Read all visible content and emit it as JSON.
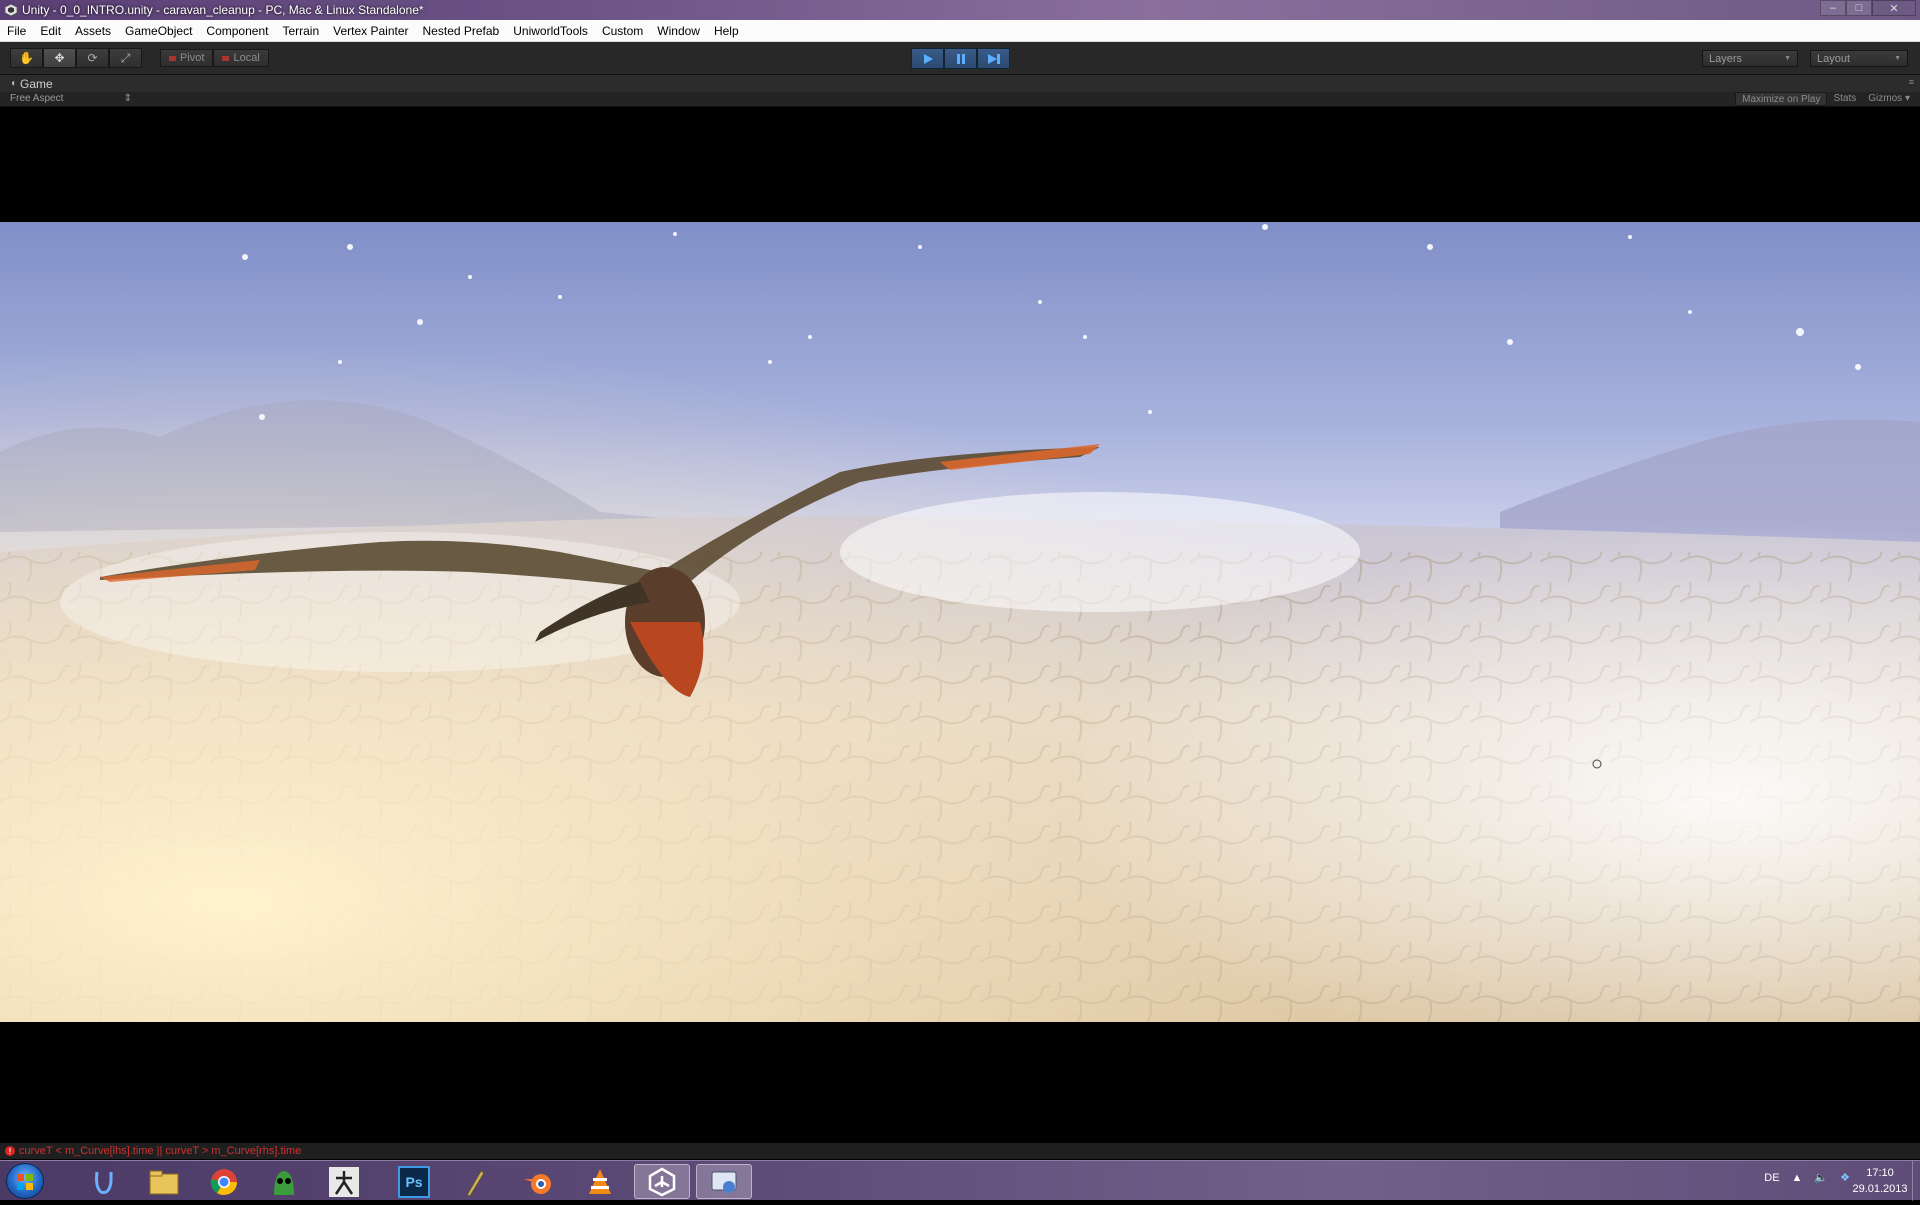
{
  "window": {
    "title": "Unity - 0_0_INTRO.unity - caravan_cleanup - PC, Mac & Linux Standalone*",
    "controls": {
      "minimize": "–",
      "maximize": "□",
      "close": "✕"
    }
  },
  "menu": {
    "items": [
      "File",
      "Edit",
      "Assets",
      "GameObject",
      "Component",
      "Terrain",
      "Vertex Painter",
      "Nested Prefab",
      "UniworldTools",
      "Custom",
      "Window",
      "Help"
    ]
  },
  "toolbar": {
    "tools": [
      {
        "name": "hand-tool",
        "glyph": "✋"
      },
      {
        "name": "move-tool",
        "glyph": "✥"
      },
      {
        "name": "rotate-tool",
        "glyph": "⟳"
      },
      {
        "name": "scale-tool",
        "glyph": "⤢"
      }
    ],
    "pivot_label": "Pivot",
    "local_label": "Local",
    "layers_label": "Layers",
    "layout_label": "Layout",
    "play_color": "#3a5b86"
  },
  "game_panel": {
    "tab_label": "Game",
    "aspect_label": "Free Aspect",
    "maximize_label": "Maximize on Play",
    "stats_label": "Stats",
    "gizmos_label": "Gizmos"
  },
  "console": {
    "message": "curveT < m_Curve[lhs].time || curveT > m_Curve[rhs].time",
    "color": "#d03030"
  },
  "taskbar": {
    "apps": [
      "uvlayout",
      "explorer",
      "chrome",
      "zbrush-goz",
      "zbrush",
      "photoshop",
      "pen-tool",
      "blender",
      "vlc",
      "unity",
      "remote"
    ],
    "photoshop_label": "Ps",
    "language": "DE",
    "time": "17:10",
    "date": "29.01.2013"
  }
}
